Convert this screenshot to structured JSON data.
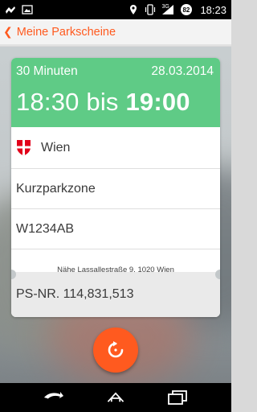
{
  "statusbar": {
    "time": "18:23",
    "battery_level": "82",
    "network_type": "3G",
    "icons": [
      "notification-icon",
      "image-icon",
      "location-icon",
      "vibrate-icon",
      "signal-icon",
      "battery-icon"
    ]
  },
  "actionbar": {
    "title": "Meine Parkscheine"
  },
  "ticket": {
    "duration": "30 Minuten",
    "date": "28.03.2014",
    "time_start": "18:30 bis ",
    "time_end": "19:00",
    "city": "Wien",
    "zone": "Kurzparkzone",
    "plate": "W1234AB",
    "address": "Nähe Lassallestraße 9, 1020 Wien",
    "ps_number": "PS-NR. 114,831,513"
  },
  "colors": {
    "accent": "#ff5a1f",
    "header_green": "#5fcb86",
    "vienna_red": "#e2001a"
  }
}
